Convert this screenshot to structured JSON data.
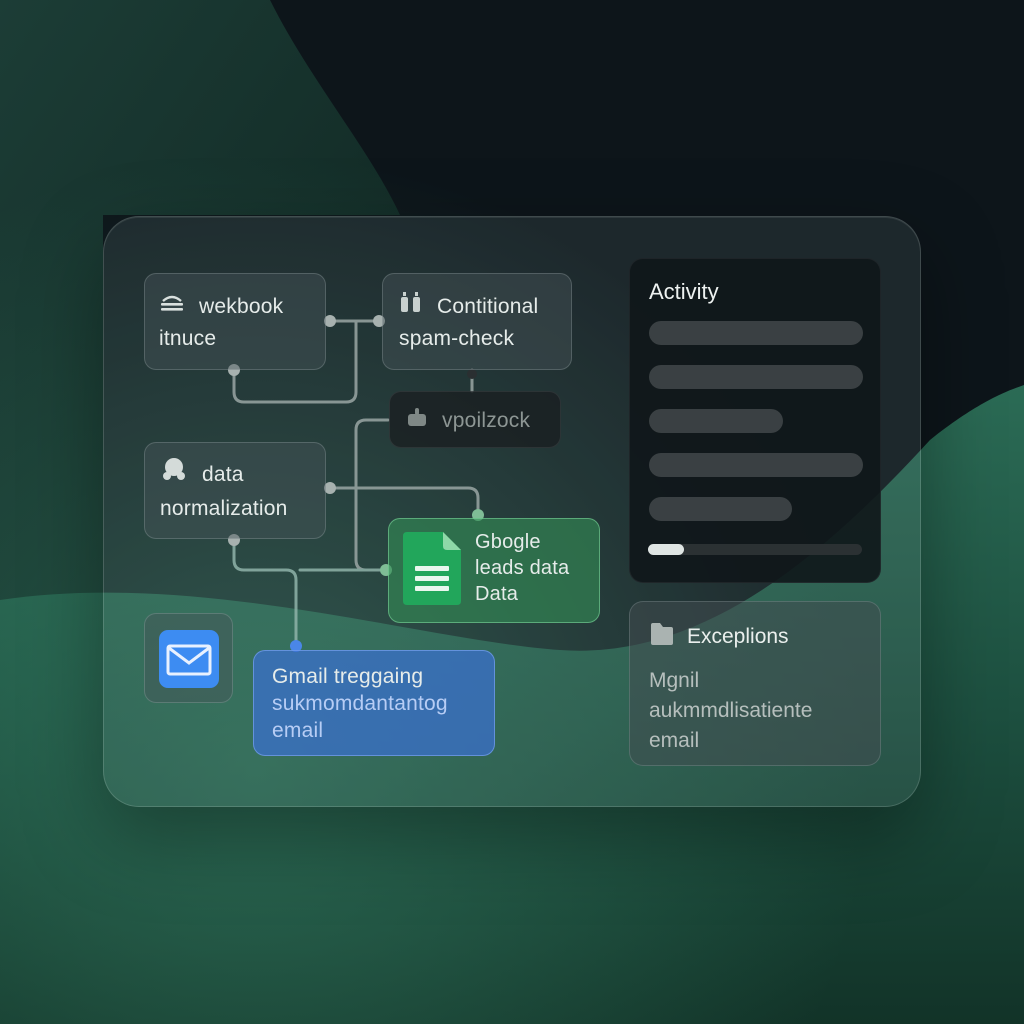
{
  "nodes": {
    "webhook": {
      "line1": "wekbook",
      "line2": "itnuce",
      "icon": "database-stack-icon"
    },
    "conditional": {
      "line1": "Contitional",
      "line2": "spam-check",
      "icon": "filter-split-icon"
    },
    "vpoil": {
      "label": "vpoilzock",
      "icon": "lock-icon"
    },
    "data_norm": {
      "line1": "data",
      "line2": "normalization",
      "icon": "cloud-icon"
    },
    "sheets": {
      "line1": "Gbogle",
      "line2": "leads data",
      "line3": "Data",
      "icon": "google-sheets-icon"
    },
    "mail": {
      "icon": "mail-envelope-icon"
    },
    "gmail": {
      "line1": "Gmail treggaing",
      "line2": "sukmomdantantog",
      "line3": "email"
    }
  },
  "activity": {
    "title": "Activity",
    "progress": 0.17
  },
  "exceptions": {
    "title": "Exceplions",
    "icon": "folder-icon",
    "line1": "Mgnil",
    "line2": "aukmmdlisatiente",
    "line3": "email"
  },
  "colors": {
    "panel_green_accent": "#3f9a63",
    "gmail_blue": "#3b70d0",
    "sheets_green": "#1ea362",
    "mail_blue": "#3d8cf2"
  }
}
